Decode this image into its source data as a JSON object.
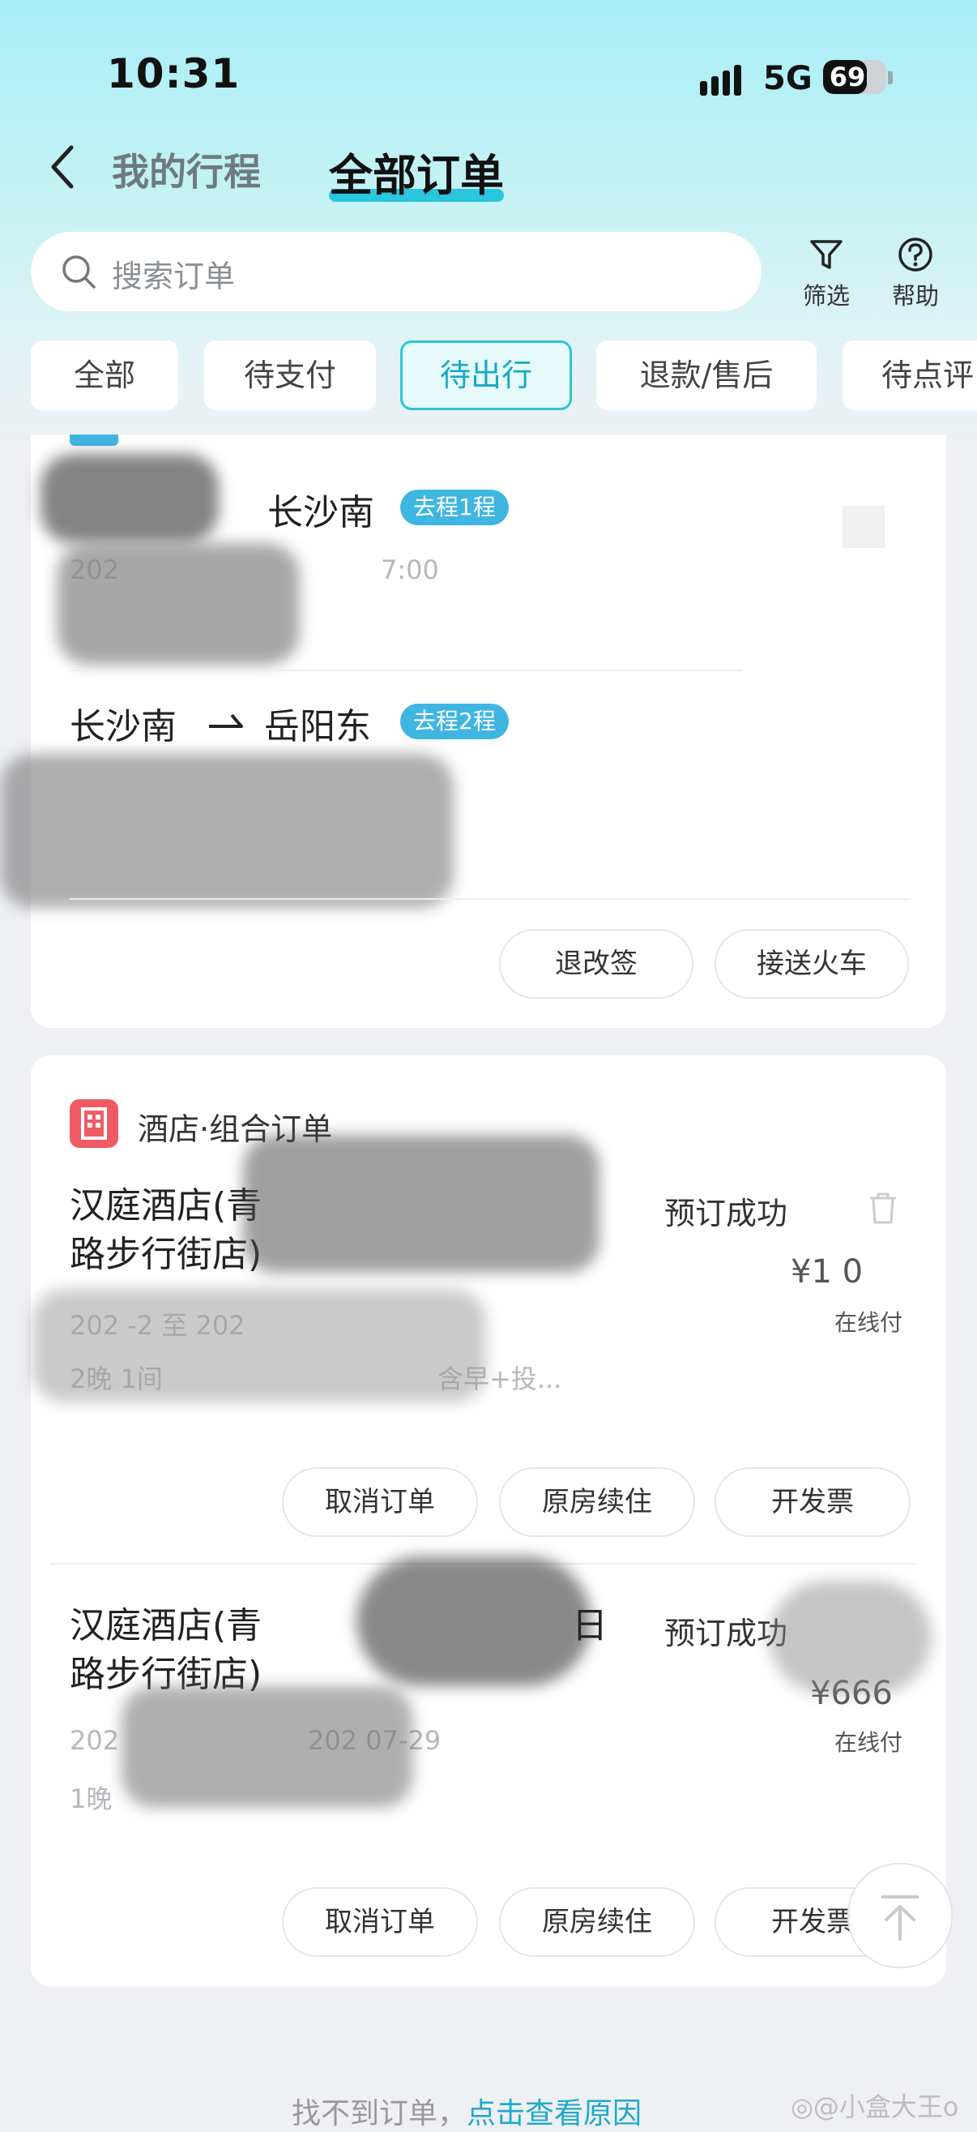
{
  "status_bar": {
    "time": "10:31",
    "network": "5G",
    "battery": "69",
    "battery_level": 0.69
  },
  "header": {
    "tab_trips": "我的行程",
    "tab_orders": "全部订单"
  },
  "search": {
    "placeholder": "搜索订单"
  },
  "toolbar": {
    "filter_label": "筛选",
    "help_label": "帮助"
  },
  "chips": [
    {
      "label": "全部"
    },
    {
      "label": "待支付"
    },
    {
      "label": "待出行"
    },
    {
      "label": "退款/售后"
    },
    {
      "label": "待点评"
    }
  ],
  "train_card": {
    "leg1": {
      "to": "长沙南",
      "badge": "去程1程",
      "date_fragment": "202",
      "time_fragment": "7:00"
    },
    "leg2": {
      "from": "长沙南",
      "to": "岳阳东",
      "badge": "去程2程"
    },
    "buttons": {
      "change": "退改签",
      "transfer": "接送火车"
    }
  },
  "hotel_card": {
    "section_label": "酒店·组合订单",
    "order1": {
      "name_line1": "汉庭酒店(青",
      "name_line2": "路步行街店)",
      "status": "预订成功",
      "price": "¥1  0",
      "pay_type": "在线付",
      "dates": "202   -2  至 202",
      "nights_rooms": "2晚 1间",
      "extras": "  含早+投..."
    },
    "order1_buttons": {
      "cancel": "取消订单",
      "renew": "原房续住",
      "invoice": "开发票"
    },
    "order2": {
      "name_line1": "汉庭酒店(青",
      "name_fragment": "日",
      "name_line2": "路步行街店)",
      "status": "预订成功",
      "price": "¥666",
      "pay_type": "在线付",
      "date_start": "202",
      "date_end": "202  07-29",
      "nights": "1晚"
    },
    "order2_buttons": {
      "cancel": "取消订单",
      "renew": "原房续住",
      "invoice": "开发票"
    }
  },
  "footer": {
    "text": "找不到订单，",
    "link": "点击查看原因"
  },
  "watermark": "@小盒大王o",
  "colors": {
    "accent": "#2ec4da",
    "badge": "#3fb6e2",
    "hotel_icon": "#ef5b63",
    "link": "#1fa9c7"
  },
  "icons": [
    "back-chevron-icon",
    "search-icon",
    "filter-icon",
    "help-icon",
    "hotel-building-icon",
    "delete-icon",
    "scroll-top-icon",
    "weibo-icon"
  ]
}
